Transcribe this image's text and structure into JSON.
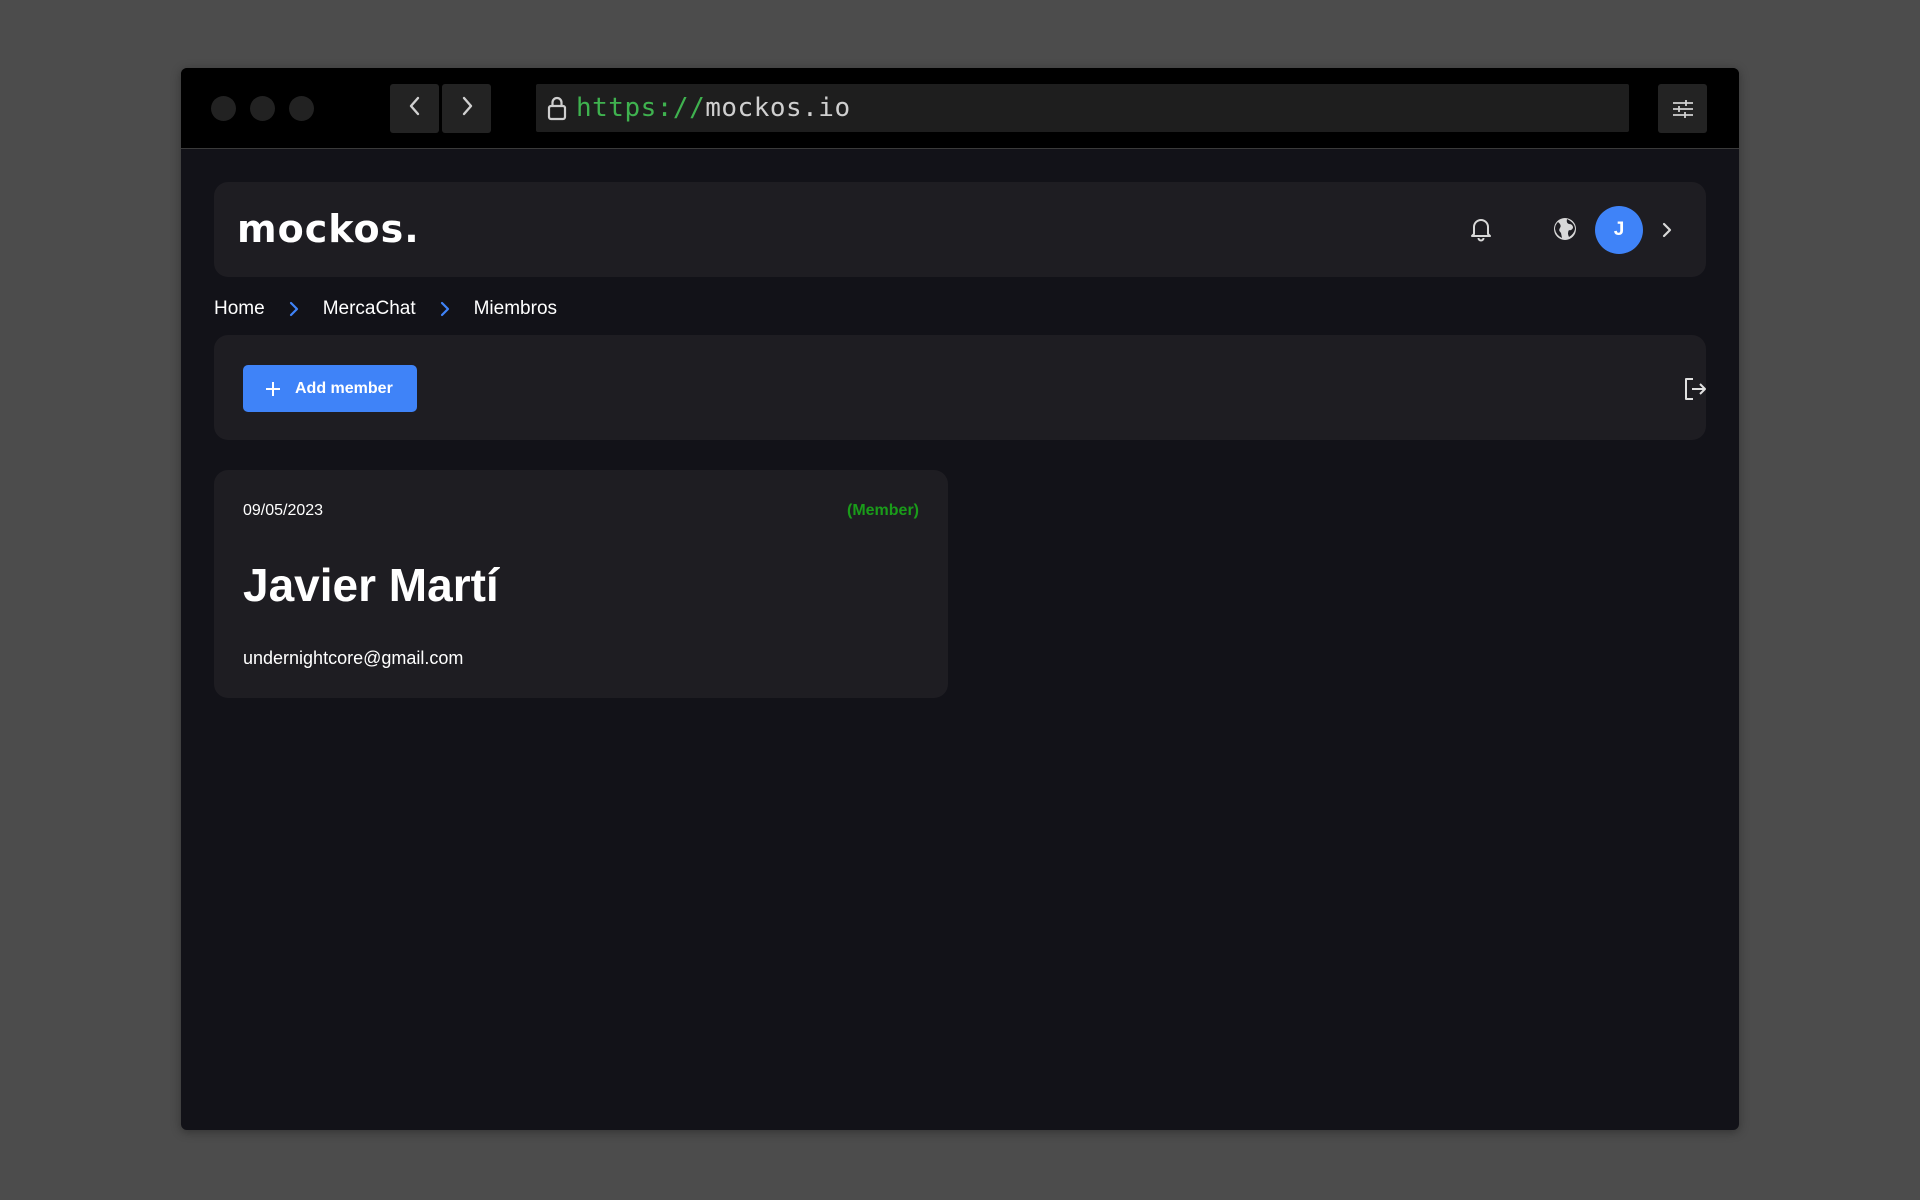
{
  "browser": {
    "url_scheme": "https://",
    "url_host": "mockos.io",
    "icons": {
      "back": "chevron-left-icon",
      "forward": "chevron-right-icon",
      "lock": "lock-icon",
      "settings": "sliders-icon"
    }
  },
  "header": {
    "logo_text": "mockos.",
    "avatar_initial": "J",
    "icons": [
      "bell-icon",
      "globe-icon",
      "chevron-right-icon"
    ]
  },
  "breadcrumb": {
    "items": [
      "Home",
      "MercaChat",
      "Miembros"
    ]
  },
  "toolbar": {
    "add_member_label": "Add member",
    "icons": [
      "plus-icon",
      "logout-icon"
    ]
  },
  "member": {
    "date": "09/05/2023",
    "role": "(Member)",
    "name": "Javier Martí",
    "email": "undernightcore@gmail.com"
  },
  "colors": {
    "accent": "#3f83f8",
    "role_green": "#1a9c1a",
    "url_green": "#3fb24f",
    "page_bg": "#121218",
    "card_bg": "#1e1d22"
  }
}
